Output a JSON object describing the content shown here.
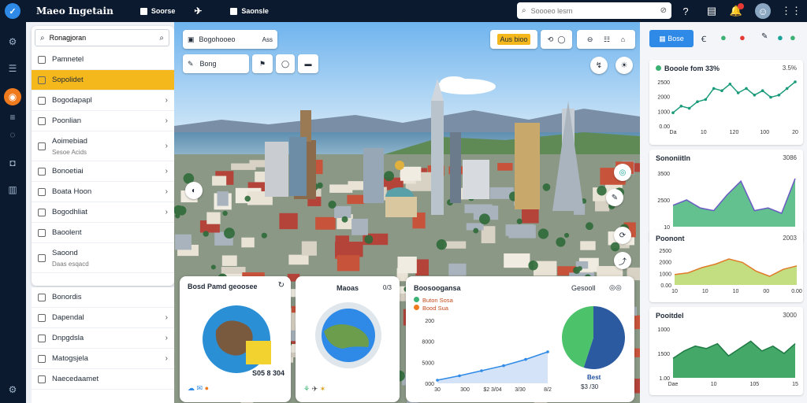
{
  "app": {
    "title": "Maeo Ingetain"
  },
  "topnav": [
    {
      "label": "Soorse"
    },
    {
      "label": "Saonsle"
    }
  ],
  "search": {
    "placeholder": "Soooeo lesrn"
  },
  "colors": {
    "topbar": "#0b1a2e",
    "accent": "#f07a1e",
    "active_item": "#f5b81c",
    "primary": "#2e8ae6",
    "green": "#3bb273"
  },
  "nav": {
    "search_value": "Ronagjoran",
    "items": [
      {
        "label": "Pamnetel",
        "chevron": false
      },
      {
        "label": "Sopolidet",
        "chevron": false,
        "active": true
      },
      {
        "label": "Bogodapapl",
        "chevron": true
      },
      {
        "label": "Poonlian",
        "chevron": true
      },
      {
        "label": "Aoimebiad",
        "sub": "Sesoe Acids",
        "chevron": true
      },
      {
        "label": "Bonoetiai",
        "chevron": true
      },
      {
        "label": "Boata Hoon",
        "chevron": true
      },
      {
        "label": "Bogodhliat",
        "chevron": true
      },
      {
        "label": "Baoolent",
        "chevron": false
      },
      {
        "label": "Saoond",
        "sub": "Daas esqacd",
        "chevron": false
      }
    ],
    "lower": [
      {
        "label": "Bonordis",
        "chevron": false
      },
      {
        "label": "Dapendal",
        "chevron": true
      },
      {
        "label": "Dnpgdsla",
        "chevron": true
      },
      {
        "label": "Matogsjela",
        "chevron": true
      },
      {
        "label": "Naecedaamet",
        "chevron": false
      }
    ]
  },
  "map": {
    "tool1": "Bogohooeo",
    "tool1b": "Ass",
    "tool2": "Bong",
    "layer_label": "Aus bioo"
  },
  "cards": {
    "c1": {
      "title": "Bosd Pamd geoosee",
      "value": "S05 8 304"
    },
    "c2": {
      "title": "Maoas",
      "value": "0/3"
    },
    "c3": {
      "title": "Boosoogansa",
      "legend": [
        "Buton Sosa",
        "Bood Sua"
      ],
      "right_title": "Gesooll",
      "legend_value": "Best",
      "legend_value2": "$3 /30"
    }
  },
  "right": {
    "tabs": [
      {
        "label": "Bose"
      }
    ],
    "card1": {
      "title": "Booole fom 33%",
      "value": "3.5%"
    },
    "card2": {
      "title": "Sononiitln",
      "value": "3086"
    },
    "card3": {
      "title": "Poonont",
      "value": "2003"
    },
    "card4": {
      "title": "Pooitdel",
      "value": "3000",
      "footer": "Dae"
    }
  },
  "chart_data": [
    {
      "type": "line",
      "title": "Booole fom 33%",
      "y_ticks": [
        "2500",
        "2000",
        "1000",
        "0.00"
      ],
      "x_ticks": [
        "Da",
        "10",
        "120",
        "100",
        "20"
      ],
      "values": [
        0.3,
        0.45,
        0.4,
        0.55,
        0.6,
        0.85,
        0.8,
        0.95,
        0.75,
        0.85,
        0.7,
        0.8,
        0.65,
        0.7,
        0.85,
        1.0
      ],
      "ylim": [
        0,
        1
      ]
    },
    {
      "type": "area",
      "title": "Sononiitln",
      "y_ticks": [
        "3500",
        "2500",
        "10"
      ],
      "x_ticks": [
        "3.0",
        "10",
        "10",
        "5.00"
      ],
      "values": [
        0.4,
        0.5,
        0.35,
        0.3,
        0.6,
        0.85,
        0.3,
        0.35,
        0.25,
        0.9
      ],
      "ylim": [
        0,
        1
      ]
    },
    {
      "type": "area",
      "title": "Poonont",
      "y_ticks": [
        "2500",
        "2000",
        "1000",
        "0.00"
      ],
      "x_ticks": [
        "10",
        "10",
        "10",
        "00",
        "0.00"
      ],
      "values": [
        0.3,
        0.35,
        0.5,
        0.6,
        0.75,
        0.65,
        0.4,
        0.25,
        0.45,
        0.55
      ],
      "ylim": [
        0,
        1
      ]
    },
    {
      "type": "area",
      "title": "Pooitdel",
      "y_ticks": [
        "1000",
        "1500",
        "1.00"
      ],
      "x_ticks": [
        "Dae",
        "10",
        "105",
        "15"
      ],
      "values": [
        0.4,
        0.55,
        0.65,
        0.6,
        0.7,
        0.45,
        0.6,
        0.75,
        0.55,
        0.65,
        0.5,
        0.7
      ],
      "ylim": [
        0,
        1
      ]
    },
    {
      "type": "line",
      "title": "Boosoogansa",
      "y_ticks": [
        "200",
        "8000",
        "5000",
        "000"
      ],
      "x_ticks": [
        "30",
        "300",
        "$2 3/04",
        "3/30",
        "8/2"
      ],
      "values": [
        0.05,
        0.12,
        0.2,
        0.28,
        0.38,
        0.5
      ],
      "ylim": [
        0,
        1
      ]
    },
    {
      "type": "pie",
      "title": "Gesooll",
      "values": [
        55,
        45
      ]
    }
  ]
}
